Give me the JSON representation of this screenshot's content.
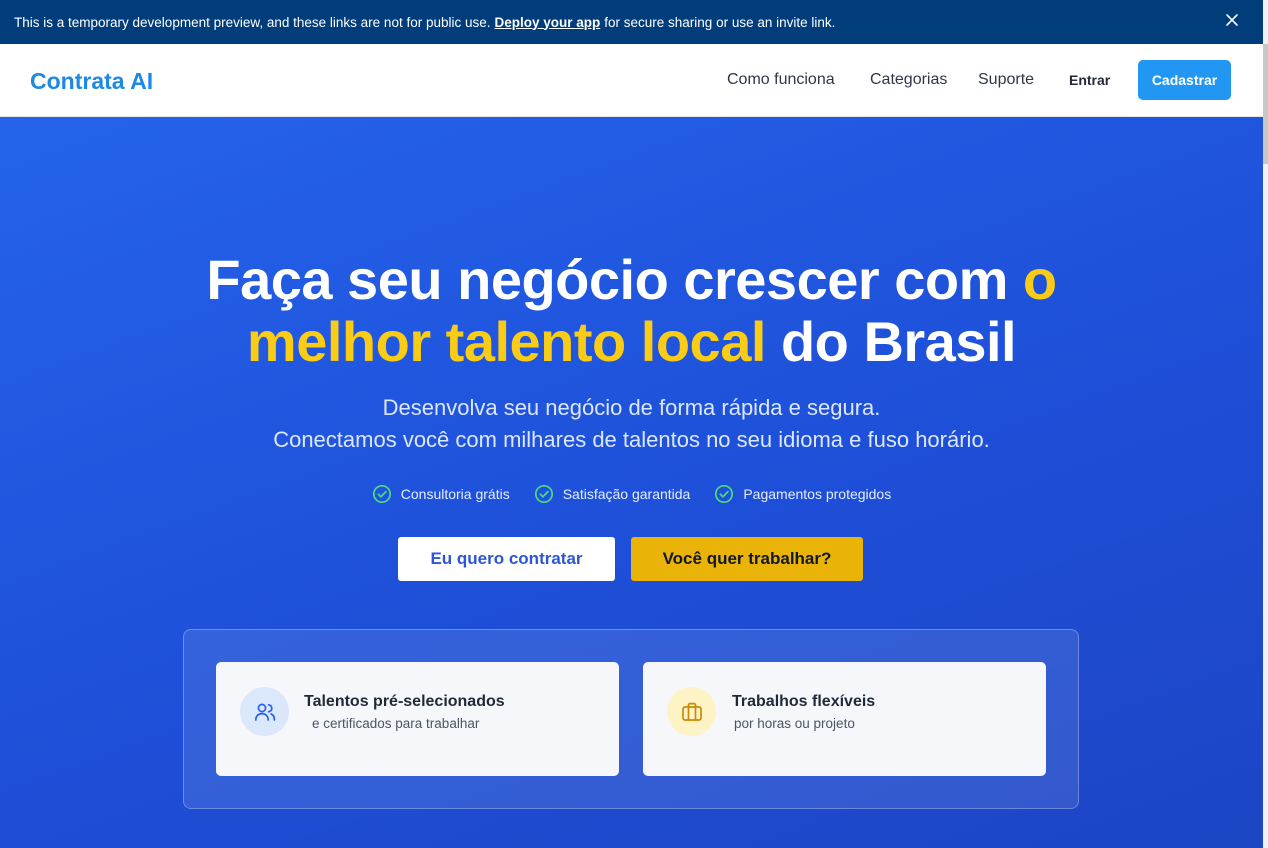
{
  "banner": {
    "text_before": "This is a temporary development preview, and these links are not for public use.",
    "link": "Deploy your app",
    "text_after": "for secure sharing or use an invite link."
  },
  "navbar": {
    "logo": "Contrata AI",
    "links": [
      "Como funciona",
      "Categorias",
      "Suporte"
    ],
    "login": "Entrar",
    "signup": "Cadastrar"
  },
  "hero": {
    "headline_part1": "Faça seu negócio crescer com",
    "headline_accent_1": "o",
    "headline_accent_2": "melhor talento local",
    "headline_part2": "do Brasil",
    "subtitle_line1": "Desenvolva seu negócio de forma rápida e segura.",
    "subtitle_line2": "Conectamos você com milhares de talentos no seu idioma e fuso horário.",
    "features": [
      "Consultoria grátis",
      "Satisfação garantida",
      "Pagamentos protegidos"
    ],
    "cta_hire": "Eu quero contratar",
    "cta_work": "Você quer trabalhar?"
  },
  "cards": [
    {
      "title": "Talentos pré-selecionados",
      "desc": "e certificados para trabalhar",
      "icon": "users-icon"
    },
    {
      "title": "Trabalhos flexíveis",
      "desc": "por horas ou projeto",
      "icon": "briefcase-icon"
    }
  ],
  "colors": {
    "banner_bg": "#003d7a",
    "brand": "#1e88e5",
    "hero_bg": "#2563eb",
    "accent": "#facc15",
    "check": "#4ade80"
  }
}
